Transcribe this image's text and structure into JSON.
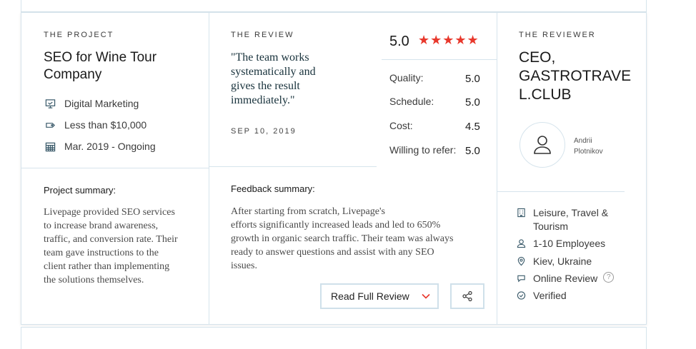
{
  "project": {
    "eyebrow": "THE PROJECT",
    "title_line1": "SEO for Wine Tour",
    "title_line2": "Company",
    "service": "Digital Marketing",
    "budget": "Less than $10,000",
    "timeline": "Mar. 2019 - Ongoing",
    "summary_heading": "Project summary:",
    "summary_lines": [
      "Livepage provided SEO services",
      "to increase brand awareness,",
      "traffic, and conversion rate. Their",
      "team gave instructions to the",
      "client rather than implementing",
      "the solutions themselves."
    ]
  },
  "review": {
    "eyebrow": "THE REVIEW",
    "quote_lines": [
      "\"The team works",
      "systematically and",
      "gives the result",
      "immediately.\""
    ],
    "date": "SEP 10, 2019",
    "overall": "5.0",
    "stars": "★★★★★",
    "ratings": [
      {
        "label": "Quality:",
        "value": "5.0"
      },
      {
        "label": "Schedule:",
        "value": "5.0"
      },
      {
        "label": "Cost:",
        "value": "4.5"
      },
      {
        "label": "Willing to refer:",
        "value": "5.0"
      }
    ],
    "feedback_heading": "Feedback summary:",
    "feedback_lines": [
      "After starting from scratch, Livepage's",
      "efforts significantly increased leads and led to 650%",
      "growth in organic search traffic. Their team was always",
      "ready to answer questions and assist with any SEO",
      "issues."
    ],
    "read_full_label": "Read Full Review"
  },
  "reviewer": {
    "eyebrow": "THE REVIEWER",
    "title_lines": [
      "CEO,",
      "GASTROTRAVE",
      "L.CLUB"
    ],
    "name_line1": "Andrii",
    "name_line2": "Plotnikov",
    "industry_line1": "Leisure, Travel &",
    "industry_line2": "Tourism",
    "employees": "1-10 Employees",
    "location": "Kiev, Ukraine",
    "review_type": "Online Review",
    "help_glyph": "?",
    "verified": "Verified"
  },
  "colors": {
    "accent": "#e8382c",
    "border": "#d6e4ec",
    "icon": "#3a5a6a"
  }
}
